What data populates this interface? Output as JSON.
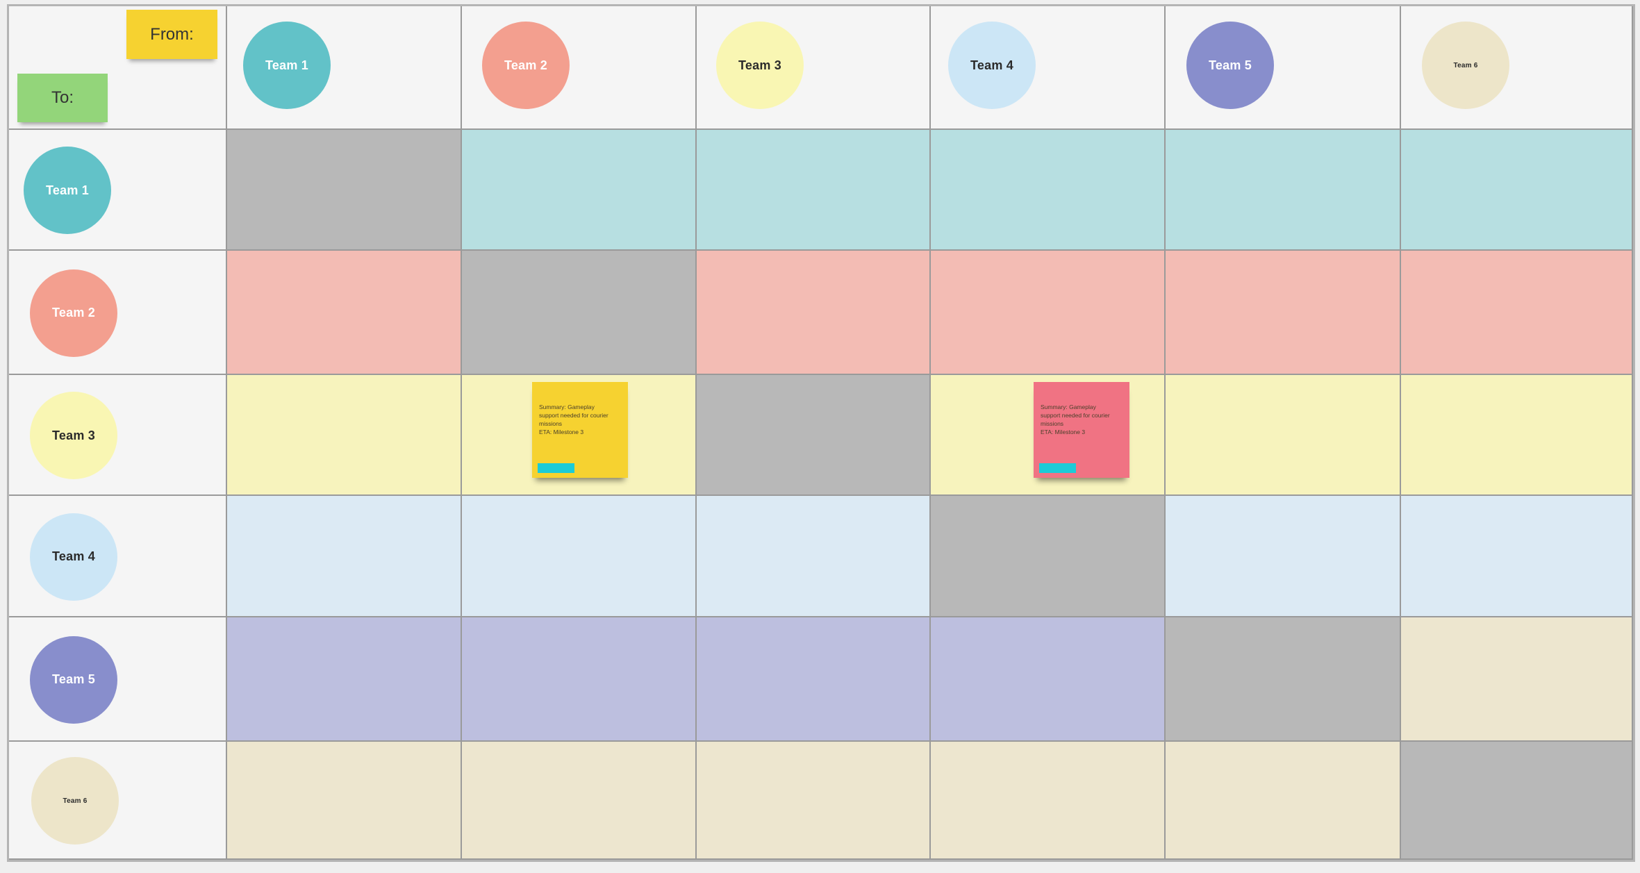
{
  "corner": {
    "from_label": "From:",
    "to_label": "To:",
    "from_color": "#f6d230",
    "to_color": "#93d57a"
  },
  "teams": [
    {
      "name": "Team 1",
      "circle_color": "#62c2c8",
      "text_color": "#ffffff",
      "row_fill": "#b7dfe1"
    },
    {
      "name": "Team 2",
      "circle_color": "#f39f8f",
      "text_color": "#ffffff",
      "row_fill": "#f3bcb4"
    },
    {
      "name": "Team 3",
      "circle_color": "#f9f6b3",
      "text_color": "#2b2b2b",
      "row_fill": "#f7f3bd"
    },
    {
      "name": "Team 4",
      "circle_color": "#cce6f6",
      "text_color": "#2b2b2b",
      "row_fill": "#dceaf4"
    },
    {
      "name": "Team 5",
      "circle_color": "#888ecc",
      "text_color": "#ffffff",
      "row_fill": "#bdbfdf"
    },
    {
      "name": "Team 6",
      "circle_color": "#ede5c9",
      "text_color": "#2b2b2b",
      "row_fill": "#ede6cf"
    }
  ],
  "diagonal_fill": "#b8b8b8",
  "cell_overrides": [
    {
      "row": 4,
      "col": 5,
      "fill": "#ede6cf"
    }
  ],
  "stickies": [
    {
      "row": 2,
      "col": 1,
      "color": "#f6d230",
      "lines": [
        "Summary: Gameplay",
        "support needed for courier",
        "missions",
        "ETA: Milestone 3"
      ],
      "tag_color": "#1ccbd7"
    },
    {
      "row": 2,
      "col": 3,
      "color": "#f07383",
      "lines": [
        "Summary: Gameplay",
        "support needed for courier",
        "missions",
        "ETA: Milestone 3"
      ],
      "tag_color": "#1ccbd7"
    }
  ]
}
